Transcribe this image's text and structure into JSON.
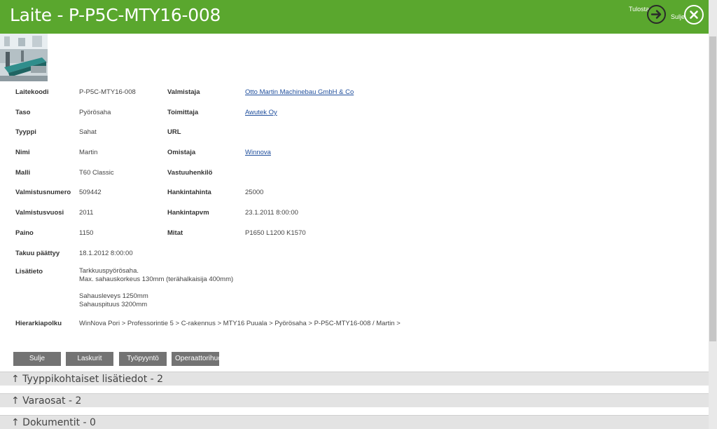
{
  "header": {
    "title": "Laite - P-P5C-MTY16-008",
    "print_label": "Tulosta",
    "close_label": "Sulje"
  },
  "details_left": [
    {
      "label": "Laitekoodi",
      "value": "P-P5C-MTY16-008"
    },
    {
      "label": "Taso",
      "value": "Pyörösaha"
    },
    {
      "label": "Tyyppi",
      "value": "Sahat"
    },
    {
      "label": "Nimi",
      "value": "Martin"
    },
    {
      "label": "Malli",
      "value": "T60 Classic"
    },
    {
      "label": "Valmistusnumero",
      "value": "509442"
    },
    {
      "label": "Valmistusvuosi",
      "value": "2011"
    },
    {
      "label": "Paino",
      "value": "1150"
    },
    {
      "label": "Takuu päättyy",
      "value": "18.1.2012 8:00:00"
    }
  ],
  "details_right": [
    {
      "label": "Valmistaja",
      "value": "Otto Martin Machinebau GmbH & Co"
    },
    {
      "label": "Toimittaja",
      "value": "Awutek Oy"
    },
    {
      "label": "URL",
      "value": ""
    },
    {
      "label": "Omistaja",
      "value": "Winnova"
    },
    {
      "label": "Vastuuhenkilö",
      "value": ""
    },
    {
      "label": "Hankintahinta",
      "value": "25000"
    },
    {
      "label": "Hankintapvm",
      "value": "23.1.2011 8:00:00"
    },
    {
      "label": "Mitat",
      "value": "P1650 L1200 K1570"
    }
  ],
  "additional": {
    "label": "Lisätieto",
    "value": "Tarkkuuspyörösaha.\nMax. sahauskorkeus 130mm (terähalkaisija 400mm)\n\nSahausleveys 1250mm\nSahauspituus 3200mm"
  },
  "hierarchy": {
    "label": "Hierarkiapolku",
    "value": "WinNova Pori > Professorintie 5 > C-rakennus > MTY16 Puuala > Pyörösaha > P-P5C-MTY16-008 / Martin >"
  },
  "buttons": {
    "close": "Sulje",
    "counters": "Laskurit",
    "work_request": "Työpyyntö",
    "operator": "Operaattorihuolto"
  },
  "sections": [
    {
      "title": "↑ Tyyppikohtaiset lisätiedot - 2"
    },
    {
      "title": "↑ Varaosat - 2"
    },
    {
      "title": "↑ Dokumentit - 0"
    }
  ],
  "colors": {
    "header": "#5aa72e",
    "button": "#737373",
    "link": "#1f4e9c",
    "section": "#e3e3e3"
  }
}
